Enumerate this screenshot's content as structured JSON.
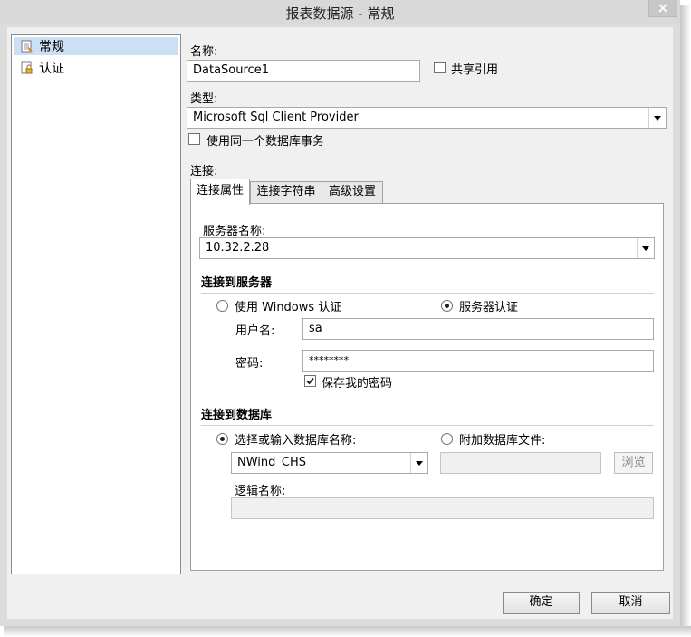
{
  "window": {
    "title": "报表数据源 - 常规",
    "close_icon": "close-icon"
  },
  "sidebar": {
    "items": [
      {
        "label": "常规",
        "icon": "page-icon",
        "selected": true
      },
      {
        "label": "认证",
        "icon": "lock-icon",
        "selected": false
      }
    ]
  },
  "general": {
    "name_label": "名称:",
    "name_value": "DataSource1",
    "shared_label": "共享引用",
    "shared_checked": false,
    "type_label": "类型:",
    "type_value": "Microsoft Sql Client Provider",
    "same_txn_label": "使用同一个数据库事务",
    "same_txn_checked": false,
    "connection_label": "连接:"
  },
  "tabs": [
    {
      "label": "连接属性",
      "active": true
    },
    {
      "label": "连接字符串",
      "active": false
    },
    {
      "label": "高级设置",
      "active": false
    }
  ],
  "connection": {
    "server_label": "服务器名称:",
    "server_value": "10.32.2.28",
    "connect_server_heading": "连接到服务器",
    "auth_windows_label": "使用 Windows 认证",
    "auth_server_label": "服务器认证",
    "auth_selected": "server",
    "username_label": "用户名:",
    "username_value": "sa",
    "password_label": "密码:",
    "password_value": "********",
    "save_password_label": "保存我的密码",
    "save_password_checked": true,
    "connect_db_heading": "连接到数据库",
    "select_db_label": "选择或输入数据库名称:",
    "attach_db_label": "附加数据库文件:",
    "db_selected": "select",
    "db_value": "NWind_CHS",
    "attach_file_value": "",
    "browse_label": "浏览",
    "logical_name_label": "逻辑名称:",
    "logical_name_value": ""
  },
  "footer": {
    "ok_label": "确定",
    "cancel_label": "取消"
  },
  "colors": {
    "selection": "#cce0f5",
    "titlebar": "#d9d9d9",
    "client": "#f0f0f0"
  }
}
